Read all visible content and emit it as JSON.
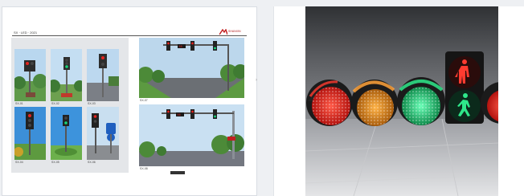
{
  "gallery": {
    "left_item": {
      "kind": "brochure-page",
      "header_text": "SX · LED · 2021",
      "logo_text": "SHANXIN",
      "captions": [
        "SX-01",
        "SX-02",
        "SX-03",
        "SX-04",
        "SX-05",
        "SX-06",
        "SX-07",
        "SX-08"
      ]
    },
    "right_item": {
      "kind": "product-photo",
      "subject": "traffic-light-modules"
    }
  },
  "colors": {
    "red_lamp": "#e5241f",
    "amber_lamp": "#e8921a",
    "green_lamp": "#19d67a",
    "pedestrian_red": "#ff3b30",
    "pedestrian_green": "#2ee88a",
    "panel_grey": "#e4e6e9"
  }
}
